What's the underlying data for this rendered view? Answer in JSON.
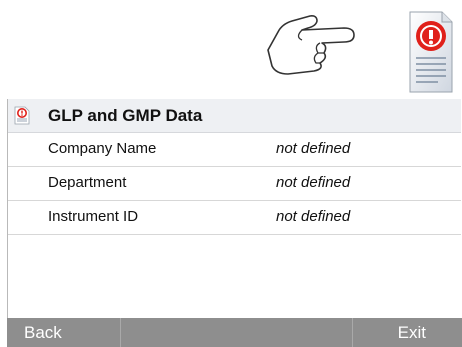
{
  "header": {
    "title": "GLP and GMP Data",
    "title_icon": "info-document-icon"
  },
  "top_icons": {
    "hand": "pointing-hand-icon",
    "document": "info-document-icon"
  },
  "rows": [
    {
      "label": "Company Name",
      "value": "not defined"
    },
    {
      "label": "Department",
      "value": "not defined"
    },
    {
      "label": "Instrument ID",
      "value": "not defined"
    }
  ],
  "footer": {
    "back_label": "Back",
    "exit_label": "Exit"
  },
  "colors": {
    "footer_bg": "#8e8e8e",
    "title_bg": "#eef0f3",
    "info_red": "#e0201a"
  }
}
